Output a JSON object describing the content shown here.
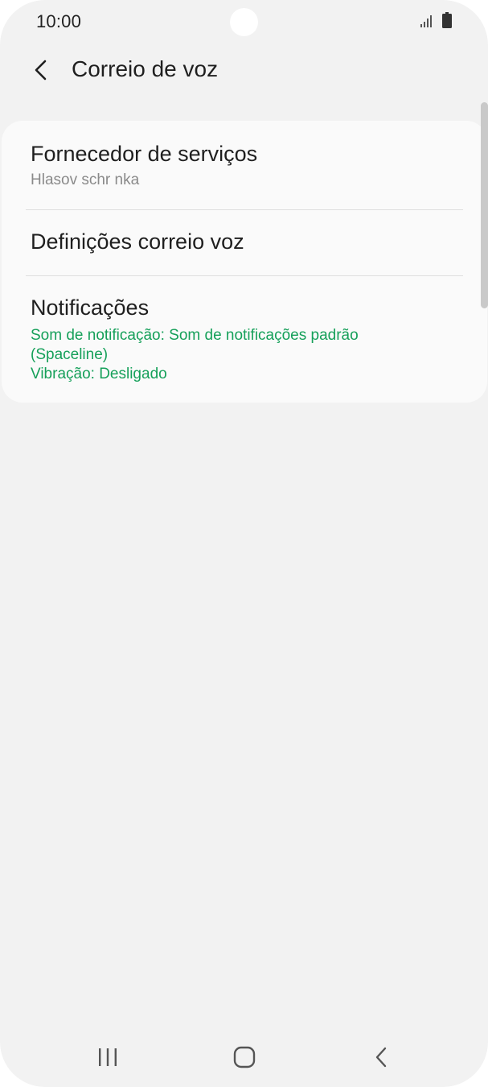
{
  "status_bar": {
    "time": "10:00"
  },
  "header": {
    "title": "Correio de voz",
    "back_icon": "chevron-left-icon"
  },
  "settings": {
    "items": [
      {
        "title": "Fornecedor de serviços",
        "subtitle": "Hlasov  schr nka"
      },
      {
        "title": "Definições correio voz"
      },
      {
        "title": "Notificações",
        "details": [
          "Som de notificação: Som de notificações padrão",
          "(Spaceline)",
          "Vibração: Desligado"
        ]
      }
    ]
  },
  "nav_bar": {
    "recents_icon": "recents-icon",
    "home_icon": "home-icon",
    "back_icon": "back-icon"
  },
  "colors": {
    "background": "#f2f2f2",
    "card": "#fafafa",
    "accent_green": "#16a05a",
    "text_primary": "#1f1f1f",
    "text_secondary": "#8a8a8a"
  }
}
